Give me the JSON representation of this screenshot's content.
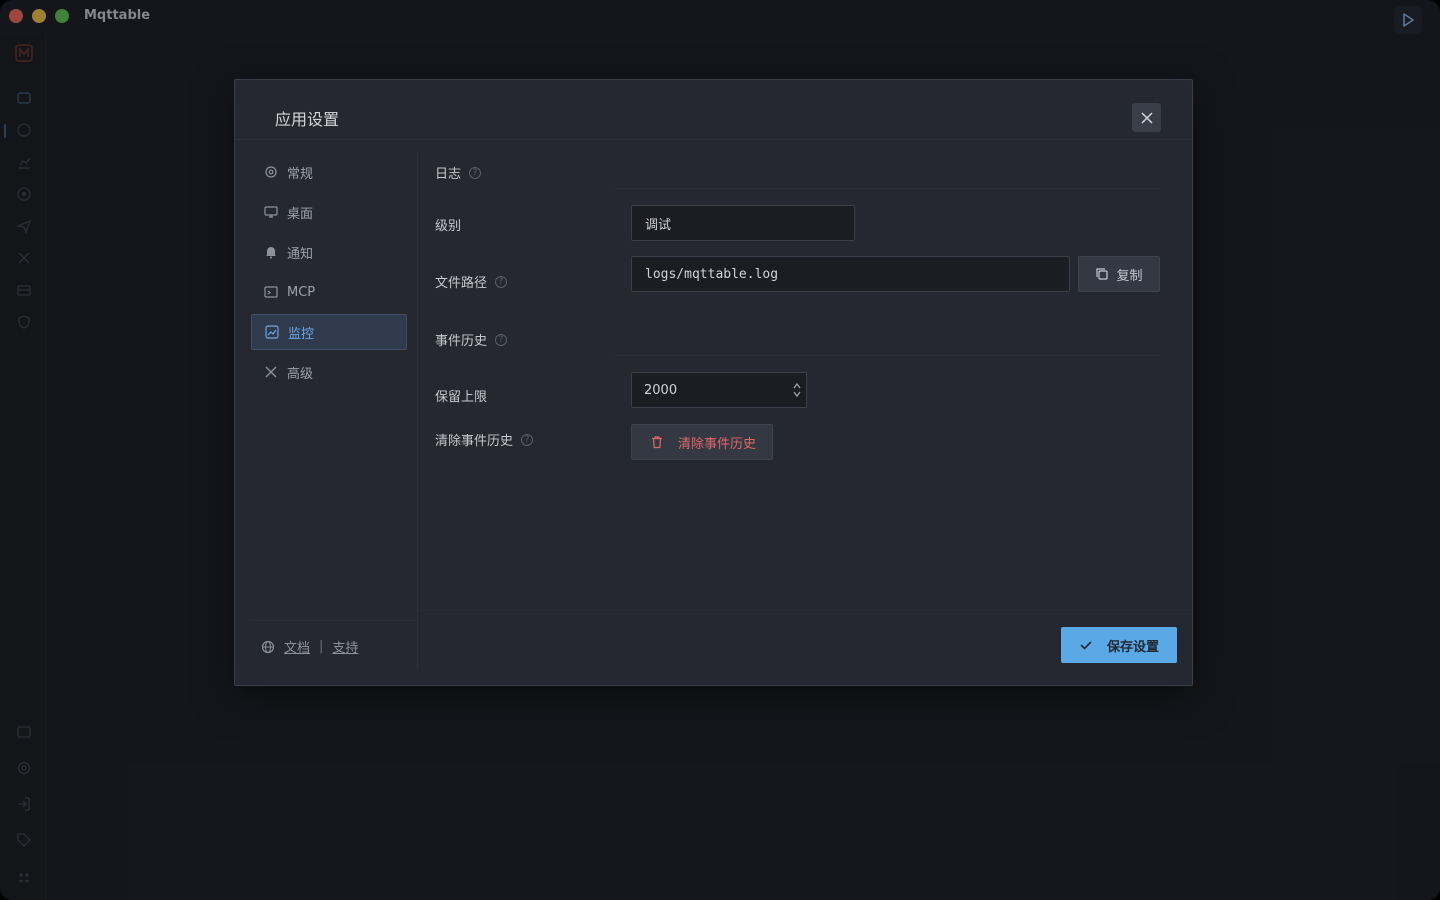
{
  "app": {
    "title": "Mqttable"
  },
  "dialog": {
    "title": "应用设置",
    "nav": [
      {
        "label": "常规",
        "icon": "gear-icon"
      },
      {
        "label": "桌面",
        "icon": "monitor-icon"
      },
      {
        "label": "通知",
        "icon": "bell-icon"
      },
      {
        "label": "MCP",
        "icon": "terminal-icon"
      },
      {
        "label": "监控",
        "icon": "chart-icon",
        "active": true
      },
      {
        "label": "高级",
        "icon": "tools-icon"
      }
    ],
    "footer": {
      "docs": "文档",
      "separator": "|",
      "support": "支持"
    },
    "log": {
      "section_title": "日志",
      "level_label": "级别",
      "level_value": "调试",
      "path_label": "文件路径",
      "path_value": "logs/mqttable.log",
      "copy_label": "复制"
    },
    "events": {
      "section_title": "事件历史",
      "limit_label": "保留上限",
      "limit_value": "2000",
      "clear_label": "清除事件历史",
      "clear_button": "清除事件历史"
    },
    "save_label": "保存设置"
  },
  "colors": {
    "accent": "#5aa9e6",
    "danger": "#e06666",
    "background": "#1c1e24",
    "dialog": "#252831"
  }
}
